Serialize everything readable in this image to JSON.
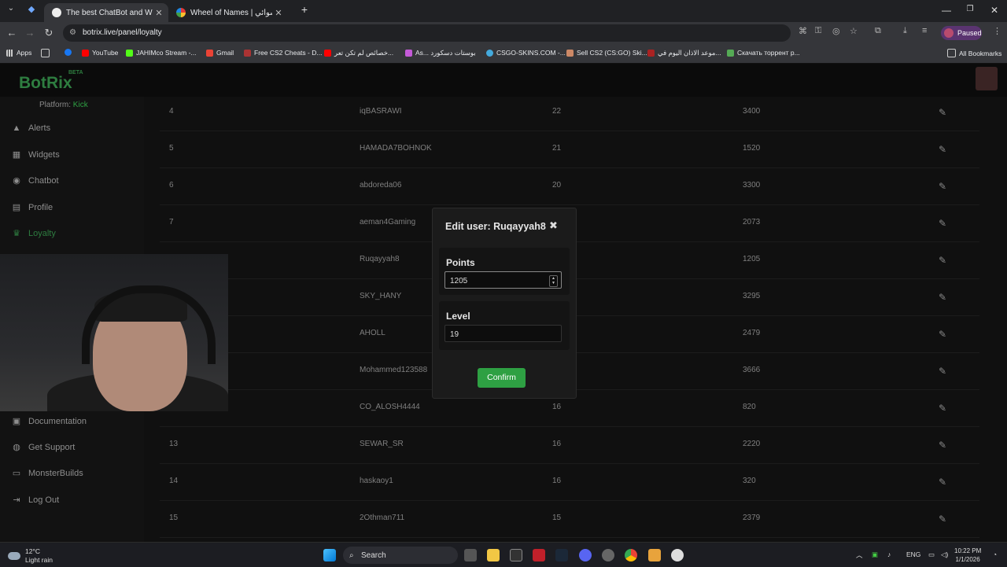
{
  "browser": {
    "tabs": [
      {
        "title": "The best ChatBot and Widgets",
        "active": true
      },
      {
        "title": "Wheel of Names | ‎اسم العشوائي",
        "active": false
      }
    ],
    "url": "botrix.live/panel/loyalty",
    "profile_label": "Paused",
    "bookmarks": [
      "Apps",
      "YouTube",
      "JAHIMco Stream -...",
      "Gmail",
      "Free CS2 Cheats - D...",
      "خصائص لم تكن تعر...",
      "As... بوستات دسكورد",
      "CSGO-SKINS.COM -...",
      "Sell CS2 (CS:GO) Ski...",
      "موعد الاذان اليوم في...",
      "Скачать торрент р..."
    ],
    "all_bookmarks": "All Bookmarks"
  },
  "app": {
    "logo": "BotRix",
    "beta": "BETA",
    "platform_label": "Platform:",
    "platform_value": "Kick",
    "nav": [
      {
        "label": "Alerts",
        "icon": "warning-icon"
      },
      {
        "label": "Widgets",
        "icon": "grid-icon"
      },
      {
        "label": "Chatbot",
        "icon": "robot-icon"
      },
      {
        "label": "Profile",
        "icon": "id-card-icon"
      },
      {
        "label": "Loyalty",
        "icon": "trophy-icon",
        "active": true
      },
      {
        "label": "Documentation",
        "icon": "scroll-icon"
      },
      {
        "label": "Get Support",
        "icon": "life-ring-icon"
      },
      {
        "label": "MonsterBuilds",
        "icon": "monitor-icon"
      },
      {
        "label": "Log Out",
        "icon": "logout-icon"
      }
    ],
    "table_rows": [
      {
        "rank": "4",
        "user": "iqBASRAWI",
        "level": "22",
        "points": "3400"
      },
      {
        "rank": "5",
        "user": "HAMADA7BOHNOK",
        "level": "21",
        "points": "1520"
      },
      {
        "rank": "6",
        "user": "abdoreda06",
        "level": "20",
        "points": "3300"
      },
      {
        "rank": "7",
        "user": "aeman4Gaming",
        "level": "",
        "points": "2073"
      },
      {
        "rank": "",
        "user": "Ruqayyah8",
        "level": "",
        "points": "1205"
      },
      {
        "rank": "",
        "user": "SKY_HANY",
        "level": "",
        "points": "3295"
      },
      {
        "rank": "",
        "user": "AHOLL",
        "level": "",
        "points": "2479"
      },
      {
        "rank": "",
        "user": "Mohammed123588",
        "level": "",
        "points": "3666"
      },
      {
        "rank": "",
        "user": "CO_ALOSH4444",
        "level": "16",
        "points": "820"
      },
      {
        "rank": "13",
        "user": "SEWAR_SR",
        "level": "16",
        "points": "2220"
      },
      {
        "rank": "14",
        "user": "haskaoy1",
        "level": "16",
        "points": "320"
      },
      {
        "rank": "15",
        "user": "2Othman711",
        "level": "15",
        "points": "2379"
      }
    ]
  },
  "modal": {
    "title": "Edit user: Ruqayyah8",
    "points_label": "Points",
    "points_value": "1205",
    "level_label": "Level",
    "level_value": "19",
    "confirm_label": "Confirm"
  },
  "taskbar": {
    "temperature": "12°C",
    "weather": "Light rain",
    "search_label": "Search",
    "language": "ENG",
    "time": "10:22 PM",
    "date": "1/1/2026"
  }
}
